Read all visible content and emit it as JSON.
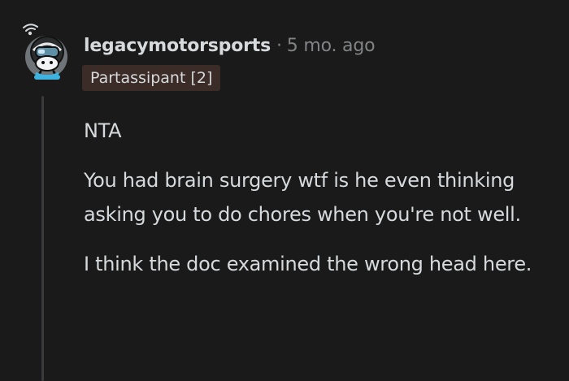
{
  "comment": {
    "username": "legacymotorsports",
    "separator": "·",
    "timestamp": "5 mo. ago",
    "flair": "Partassipant [2]",
    "paragraphs": [
      "NTA",
      "You had brain surgery wtf is he even thinking asking you to do chores when you're not well.",
      "I think the doc examined the wrong head here."
    ],
    "avatar_icon": "snoo-helmet-avatar-icon"
  },
  "colors": {
    "background": "#1a1a1b",
    "text": "#d7dadc",
    "muted": "#818384",
    "flair_bg": "#3b2c28",
    "thread_line": "#3a3a3c"
  }
}
